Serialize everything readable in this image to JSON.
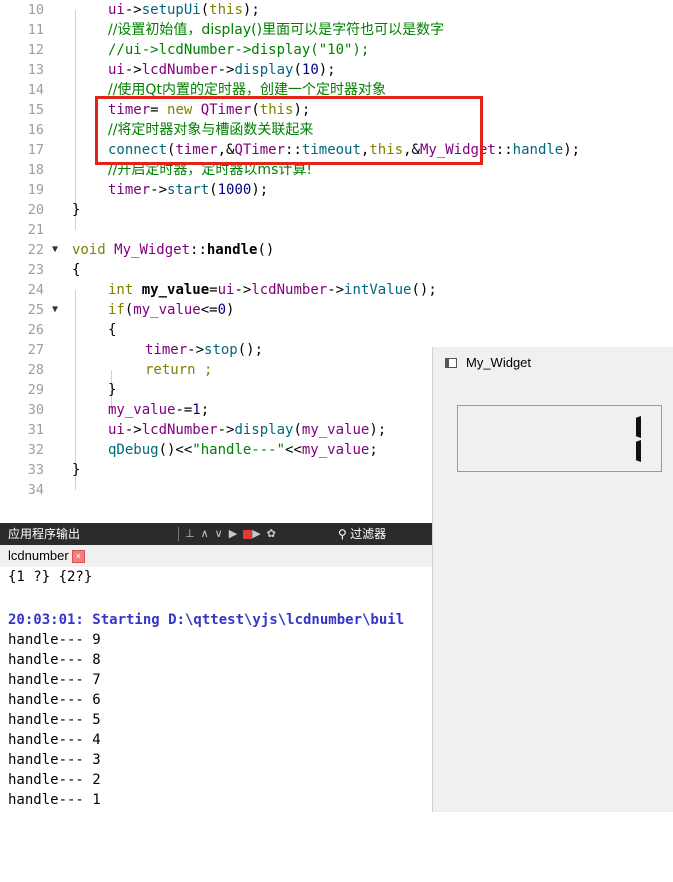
{
  "editor": {
    "lines": [
      {
        "num": "10",
        "code": "ui->setupUi(this);"
      },
      {
        "num": "11",
        "code": "//设置初始值，display()里面可以是字符也可以是数字"
      },
      {
        "num": "12",
        "code": "//ui->lcdNumber->display(\"10\");"
      },
      {
        "num": "13",
        "code": "ui->lcdNumber->display(10);"
      },
      {
        "num": "14",
        "code": "//使用Qt内置的定时器，创建一个定时器对象"
      },
      {
        "num": "15",
        "code": "timer= new QTimer(this);"
      },
      {
        "num": "16",
        "code": "//将定时器对象与槽函数关联起来"
      },
      {
        "num": "17",
        "code": "connect(timer,&QTimer::timeout,this,&My_Widget::handle);"
      },
      {
        "num": "18",
        "code": "//开启定时器，定时器以ms计算!"
      },
      {
        "num": "19",
        "code": "timer->start(1000);"
      },
      {
        "num": "20",
        "code": "}"
      },
      {
        "num": "21",
        "code": ""
      },
      {
        "num": "22",
        "code": "void My_Widget::handle()"
      },
      {
        "num": "23",
        "code": "{"
      },
      {
        "num": "24",
        "code": "int my_value=ui->lcdNumber->intValue();"
      },
      {
        "num": "25",
        "code": "if(my_value<=0)"
      },
      {
        "num": "26",
        "code": "{"
      },
      {
        "num": "27",
        "code": "timer->stop();"
      },
      {
        "num": "28",
        "code": "return ;"
      },
      {
        "num": "29",
        "code": "}"
      },
      {
        "num": "30",
        "code": "my_value-=1;"
      },
      {
        "num": "31",
        "code": "ui->lcdNumber->display(my_value);"
      },
      {
        "num": "32",
        "code": "qDebug()<<\"handle---\"<<my_value;"
      },
      {
        "num": "33",
        "code": "}"
      },
      {
        "num": "34",
        "code": ""
      }
    ]
  },
  "output_panel": {
    "title": "应用程序输出",
    "filter_placeholder": "过滤器",
    "tab_label": "lcdnumber",
    "tab_close": "×",
    "lines": [
      "{1 ?} {2?}",
      "",
      "20:03:01: Starting D:\\qttest\\yjs\\lcdnumber\\buil",
      "handle--- 9",
      "handle--- 8",
      "handle--- 7",
      "handle--- 6",
      "handle--- 5",
      "handle--- 4",
      "handle--- 3",
      "handle--- 2",
      "handle--- 1"
    ]
  },
  "widget_window": {
    "title": "My_Widget",
    "lcd_value": "1"
  },
  "colors": {
    "highlight_box": "#e2231a",
    "comment": "#008000",
    "keyword": "#808000",
    "identifier": "#800080",
    "run_output": "#3535c8"
  }
}
